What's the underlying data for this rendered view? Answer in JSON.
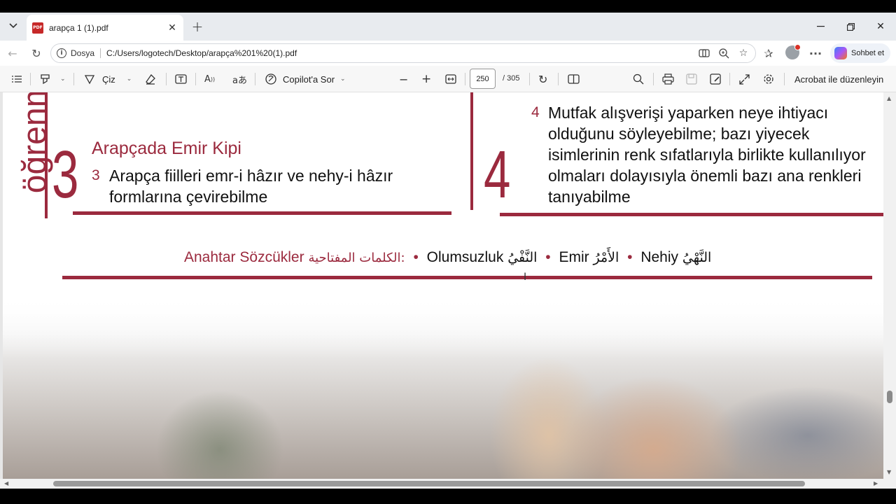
{
  "browser": {
    "tab_title": "arapça 1 (1).pdf",
    "url_scheme_label": "Dosya",
    "url": "C:/Users/logotech/Desktop/arapça%201%20(1).pdf",
    "copilot_label": "Sohbet et"
  },
  "pdf_toolbar": {
    "draw_label": "Çiz",
    "copilot_ask_label": "Copilot'a Sor",
    "page_current": "250",
    "page_total": "/ 305",
    "acrobat_edit_label": "Acrobat ile düzenleyin"
  },
  "page": {
    "vertical_heading": "öğrenm",
    "left_block": {
      "big_number": "3",
      "title": "Arapçada Emir Kipi",
      "item_number": "3",
      "item_text": "Arapça fiilleri emr-i hâzır ve nehy-i hâzır formlarına çevirebilme"
    },
    "right_block": {
      "big_number": "4",
      "item_number": "4",
      "item_text": "Mutfak alışverişi yaparken neye ihtiyacı olduğunu söyleyebilme; bazı yiyecek isimlerinin renk sıfatlarıyla birlikte kullanılıyor olmaları dolayısıyla önemli bazı ana renkleri tanıyabilme"
    },
    "keywords": {
      "label": "Anahtar Sözcükler",
      "label_arabic": "الكلمات المفتاحية:",
      "dot": "•",
      "items": [
        {
          "tr": "Olumsuzluk",
          "ar": "النَّفْيُ"
        },
        {
          "tr": "Emir",
          "ar": "الأَمْرُ"
        },
        {
          "tr": "Nehiy",
          "ar": "النَّهْيُ"
        }
      ]
    }
  },
  "colors": {
    "accent": "#9b2a3e",
    "tab_bar": "#e8ebef",
    "toolbar": "#f7f7f7"
  },
  "icons": [
    "tab-list-icon",
    "pdf-file-icon",
    "close-icon",
    "plus-icon",
    "minimize-icon",
    "restore-icon",
    "back-icon",
    "reload-icon",
    "info-icon",
    "immersive-reader-icon",
    "zoom-icon",
    "favorite-star-icon",
    "favorites-icon",
    "profile-avatar",
    "more-icon",
    "copilot-icon",
    "contents-icon",
    "highlight-icon",
    "draw-icon",
    "eraser-icon",
    "text-icon",
    "read-aloud-icon",
    "translate-icon",
    "zoom-out-icon",
    "zoom-in-icon",
    "fit-page-icon",
    "rotate-icon",
    "page-view-icon",
    "search-icon",
    "print-icon",
    "save-icon",
    "save-as-icon",
    "fullscreen-icon",
    "settings-icon"
  ]
}
